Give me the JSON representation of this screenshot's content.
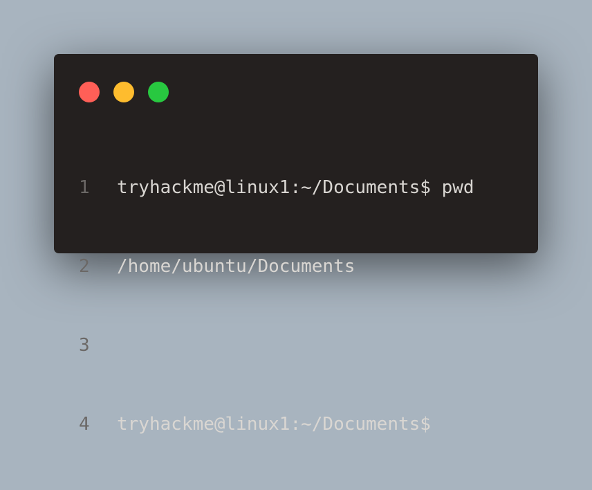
{
  "window": {
    "title": "",
    "buttons": {
      "close_color": "#ff5f57",
      "minimize_color": "#febc2e",
      "zoom_color": "#28c840"
    }
  },
  "terminal": {
    "lines": [
      {
        "number": "1",
        "text": "tryhackme@linux1:~/Documents$ pwd"
      },
      {
        "number": "2",
        "text": "/home/ubuntu/Documents"
      },
      {
        "number": "3",
        "text": ""
      },
      {
        "number": "4",
        "text": "tryhackme@linux1:~/Documents$"
      }
    ]
  }
}
